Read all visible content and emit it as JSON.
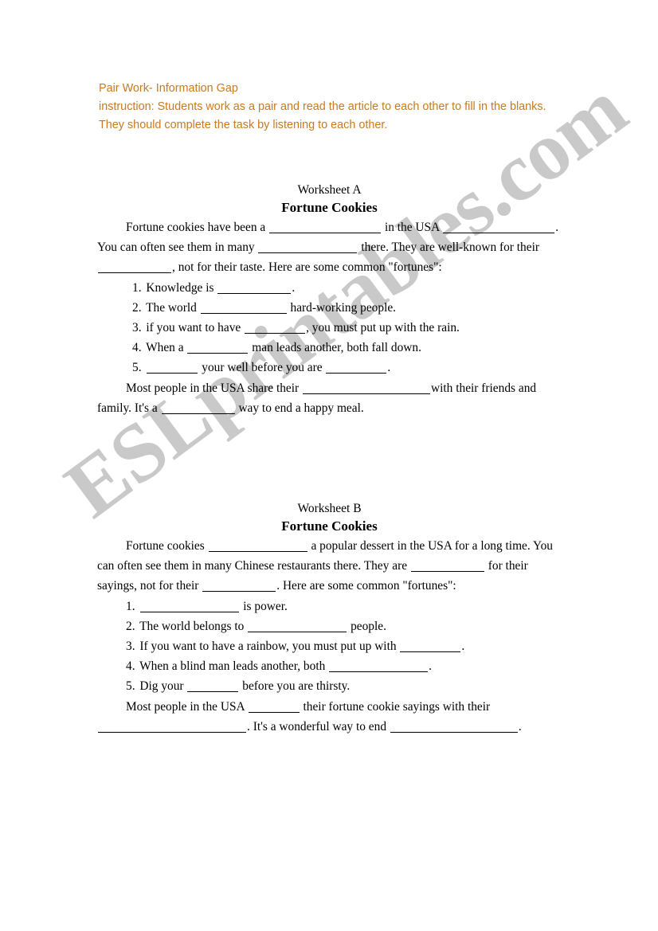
{
  "header": {
    "title": "Pair Work- Information Gap",
    "instruction": "instruction: Students work as a pair and read the article to each other to fill in the blanks. They should complete the task by listening to each other.",
    "color": "#c87a1f"
  },
  "worksheet_a": {
    "label": "Worksheet A",
    "title": "Fortune Cookies",
    "intro": {
      "t1": "Fortune cookies have been a",
      "t2": "in the USA",
      "t3": ".",
      "t4": "You can often see them in many",
      "t5": "there. They are well-known for their",
      "t6": ", not for their taste. Here are some common \"fortunes\":"
    },
    "items": [
      {
        "num": "1.",
        "t1": "Knowledge is",
        "t2": "."
      },
      {
        "num": "2.",
        "t1": "The world",
        "t2": "hard-working people."
      },
      {
        "num": "3.",
        "t1": "if you want to have",
        "t2": ", you must put up with the rain."
      },
      {
        "num": "4.",
        "t1": "When a",
        "t2": "man leads another, both fall down."
      },
      {
        "num": "5.",
        "t1": "",
        "t2": "your well before you are",
        "t3": "."
      }
    ],
    "outro": {
      "t1": "Most people in the USA share their",
      "t2": "with their friends and family. It's a",
      "t3": "way to end a happy meal."
    }
  },
  "worksheet_b": {
    "label": "Worksheet B",
    "title": "Fortune Cookies",
    "intro": {
      "t1": "Fortune cookies",
      "t2": "a popular dessert in the USA for a long time. You can often see them in many Chinese restaurants there. They are",
      "t3": "for their sayings, not for their",
      "t4": ". Here are some common \"fortunes\":"
    },
    "items": [
      {
        "num": "1.",
        "t1": "",
        "t2": "is power."
      },
      {
        "num": "2.",
        "t1": "The world belongs to",
        "t2": "people."
      },
      {
        "num": "3.",
        "t1": "If you want to have a rainbow, you must put up with",
        "t2": "."
      },
      {
        "num": "4.",
        "t1": "When a blind man leads another, both",
        "t2": "."
      },
      {
        "num": "5.",
        "t1": "Dig your",
        "t2": "before you are thirsty."
      }
    ],
    "outro": {
      "t1": "Most people in the USA",
      "t2": "their fortune cookie sayings with their",
      "t3": ". It's a wonderful way to end",
      "t4": "."
    }
  },
  "watermark": {
    "text": "ESLprintables.com",
    "color": "#c9c9c9"
  }
}
